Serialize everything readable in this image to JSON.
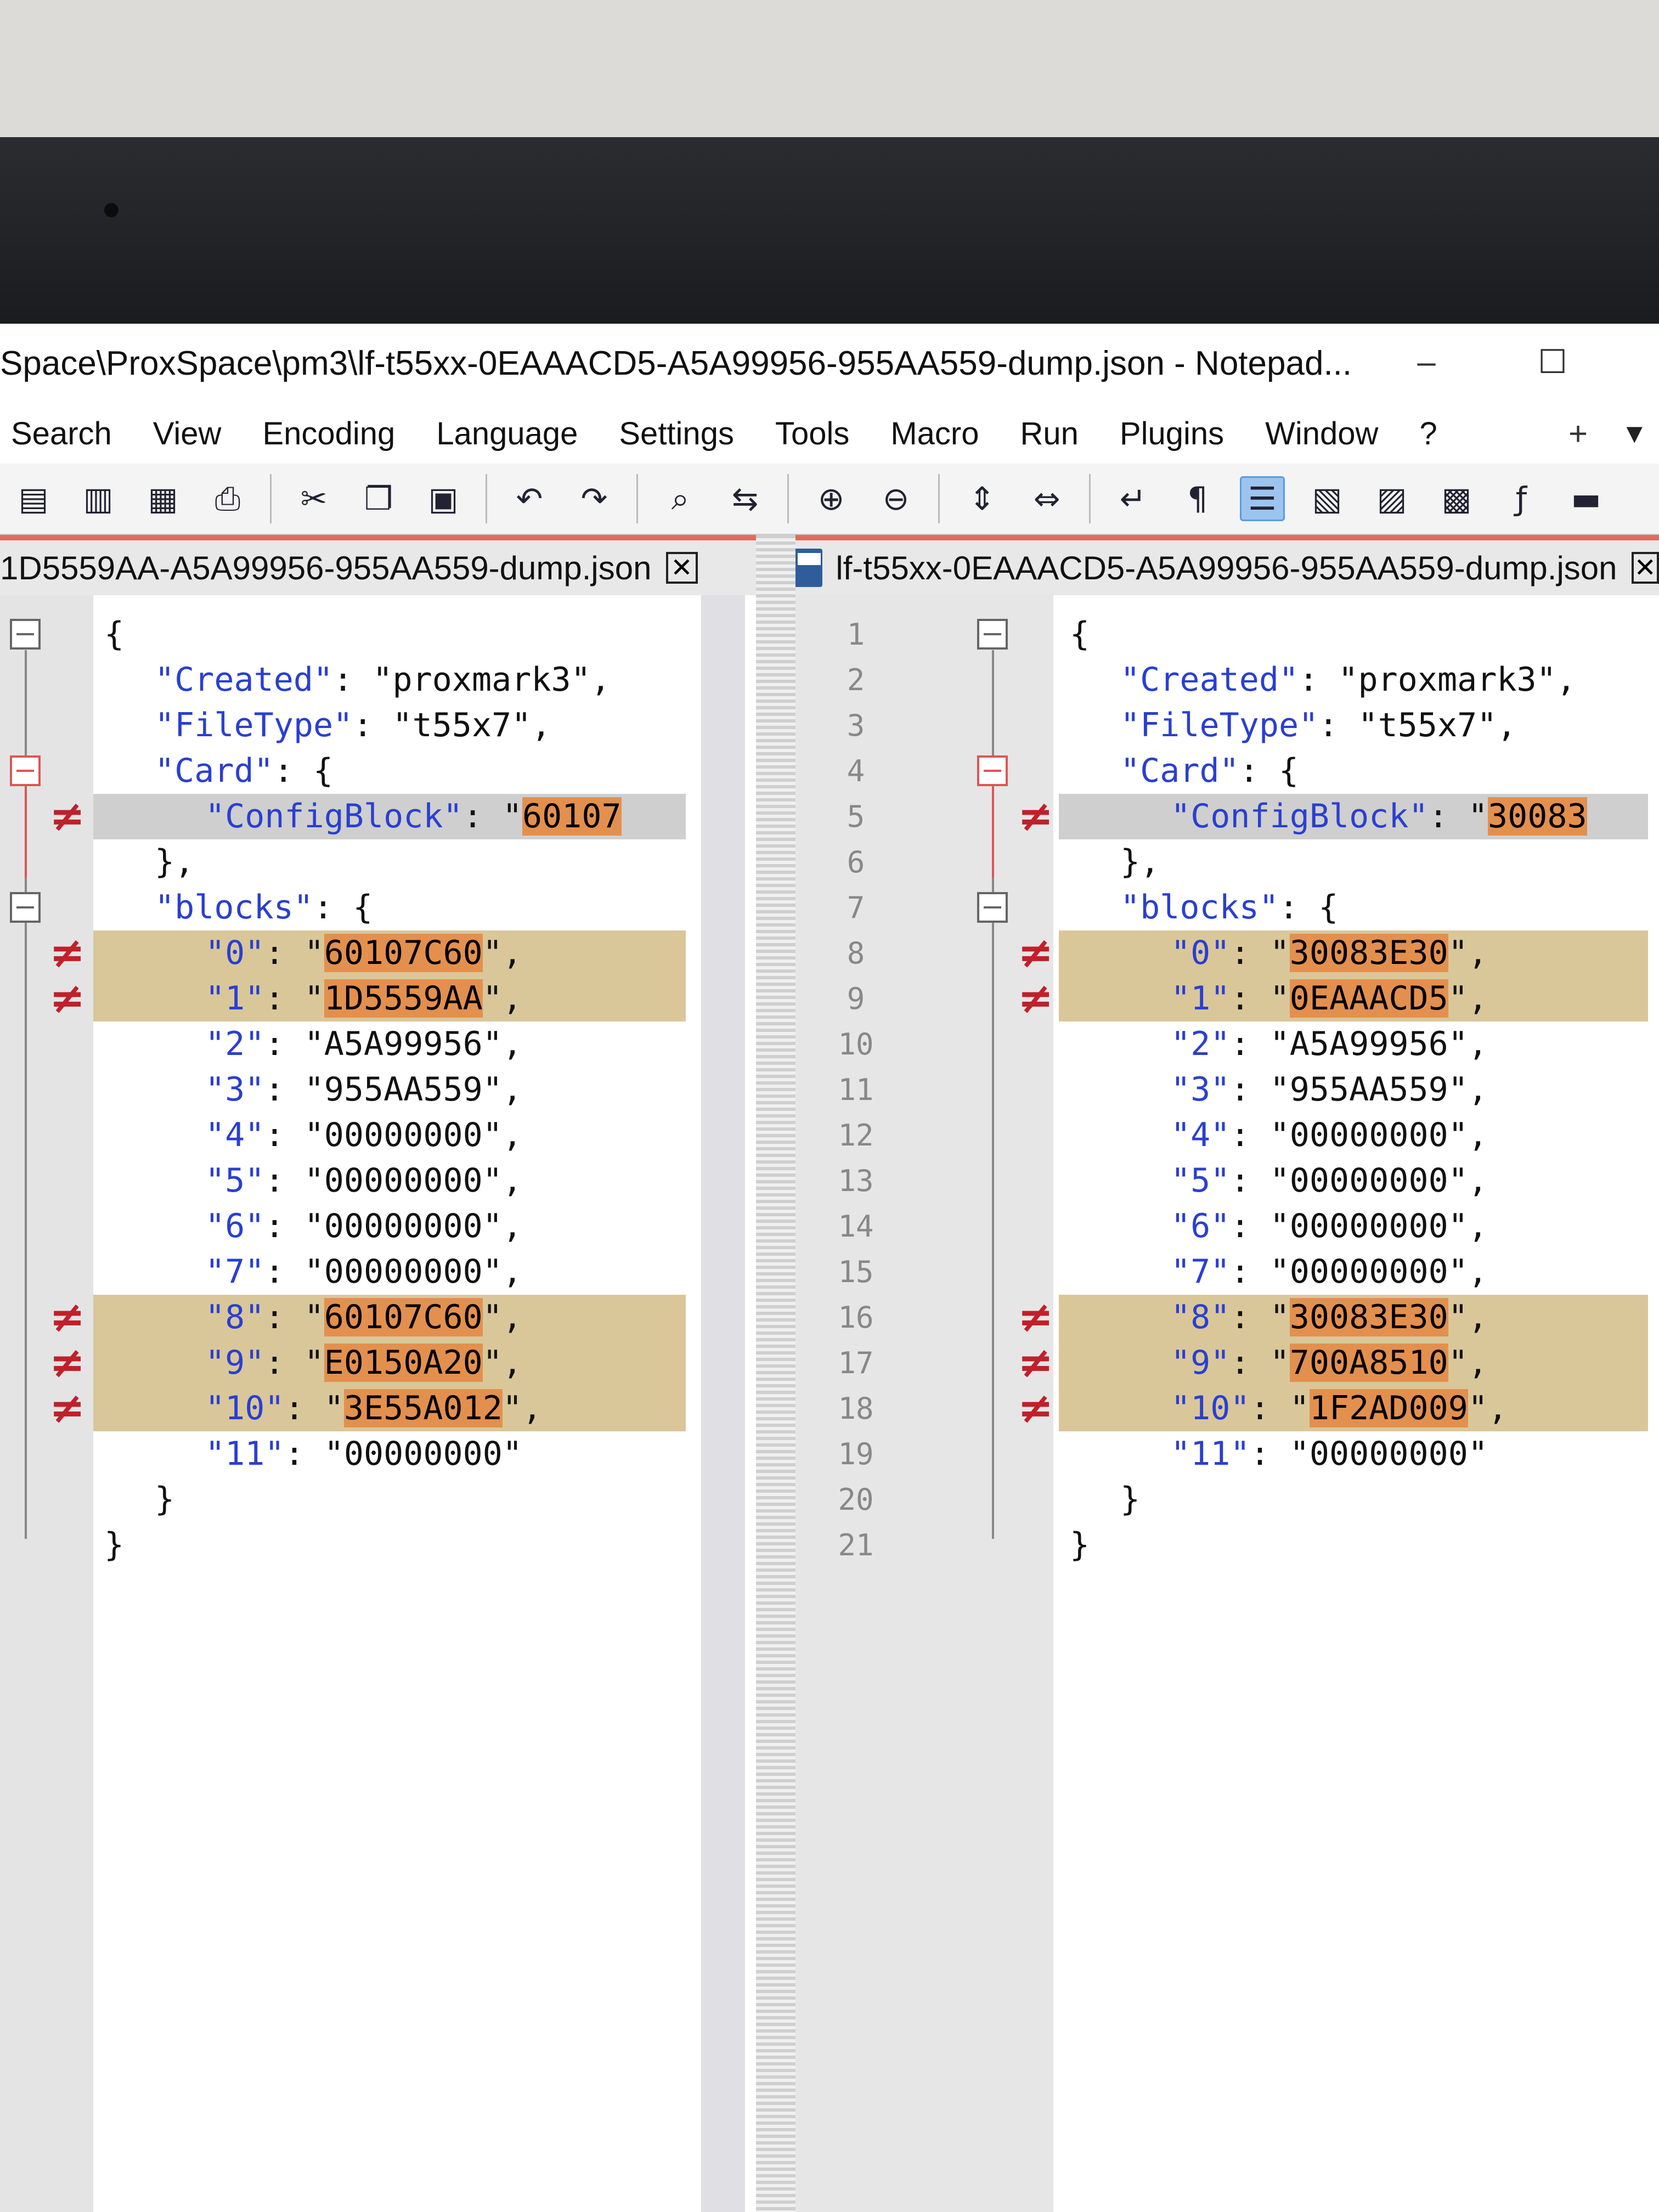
{
  "window": {
    "title": "Space\\ProxSpace\\pm3\\lf-t55xx-0EAAACD5-A5A99956-955AA559-dump.json - Notepad...",
    "minimize_glyph": "–",
    "maximize_glyph": "☐"
  },
  "menu": {
    "items": [
      "Search",
      "View",
      "Encoding",
      "Language",
      "Settings",
      "Tools",
      "Macro",
      "Run",
      "Plugins",
      "Window",
      "?"
    ],
    "plus": "+",
    "dropdown": "▼"
  },
  "toolbar": {
    "icons": [
      "new-file-icon",
      "open-file-icon",
      "save-all-icon",
      "print-icon",
      "cut-icon",
      "copy-icon",
      "paste-icon",
      "undo-icon",
      "redo-icon",
      "find-icon",
      "replace-icon",
      "zoom-in-icon",
      "zoom-out-icon",
      "sync-vertical-icon",
      "sync-horizontal-icon",
      "word-wrap-icon",
      "show-all-chars-icon",
      "indent-guide-icon",
      "doc-map-icon",
      "function-list-icon",
      "folder-workspace-icon",
      "macro-record-icon",
      "macro-stop-icon"
    ],
    "glyphs": {
      "new-file-icon": "▤",
      "open-file-icon": "▥",
      "save-all-icon": "▦",
      "print-icon": "⎙",
      "cut-icon": "✂",
      "copy-icon": "❐",
      "paste-icon": "▣",
      "undo-icon": "↶",
      "redo-icon": "↷",
      "find-icon": "⌕",
      "replace-icon": "⇆",
      "zoom-in-icon": "⊕",
      "zoom-out-icon": "⊖",
      "sync-vertical-icon": "⇕",
      "sync-horizontal-icon": "⇔",
      "word-wrap-icon": "↵",
      "show-all-chars-icon": "¶",
      "indent-guide-icon": "☰",
      "doc-map-icon": "▧",
      "function-list-icon": "▨",
      "folder-workspace-icon": "▩",
      "macro-record-icon": "ƒ",
      "macro-stop-icon": "▬"
    },
    "active": "indent-guide-icon"
  },
  "left": {
    "tab_name": "1D5559AA-A5A99956-955AA559-dump.json",
    "close_glyph": "✕",
    "lines": [
      {
        "text": "{",
        "indent": 0
      },
      {
        "key": "\"Created\"",
        "sep": ": ",
        "value": "\"proxmark3\"",
        "tail": ",",
        "indent": 1
      },
      {
        "key": "\"FileType\"",
        "sep": ": ",
        "value": "\"t55x7\"",
        "tail": ",",
        "indent": 1
      },
      {
        "key": "\"Card\"",
        "sep": ": ",
        "value": "{",
        "tail": "",
        "indent": 1
      },
      {
        "key": "\"ConfigBlock\"",
        "sep": ": ",
        "value": "\"",
        "hl": "60107",
        "tail": "",
        "indent": 2,
        "diff": "gray",
        "marker": true
      },
      {
        "text": "},",
        "indent": 1
      },
      {
        "key": "\"blocks\"",
        "sep": ": ",
        "value": "{",
        "tail": "",
        "indent": 1
      },
      {
        "key": "\"0\"",
        "sep": ": ",
        "value": "\"",
        "hl": "60107C60",
        "tail": "\",",
        "indent": 2,
        "diff": "gold",
        "marker": true
      },
      {
        "key": "\"1\"",
        "sep": ": ",
        "value": "\"",
        "hl": "1D5559AA",
        "tail": "\",",
        "indent": 2,
        "diff": "gold",
        "marker": true
      },
      {
        "key": "\"2\"",
        "sep": ": ",
        "value": "\"A5A99956\"",
        "tail": ",",
        "indent": 2
      },
      {
        "key": "\"3\"",
        "sep": ": ",
        "value": "\"955AA559\"",
        "tail": ",",
        "indent": 2
      },
      {
        "key": "\"4\"",
        "sep": ": ",
        "value": "\"00000000\"",
        "tail": ",",
        "indent": 2
      },
      {
        "key": "\"5\"",
        "sep": ": ",
        "value": "\"00000000\"",
        "tail": ",",
        "indent": 2
      },
      {
        "key": "\"6\"",
        "sep": ": ",
        "value": "\"00000000\"",
        "tail": ",",
        "indent": 2
      },
      {
        "key": "\"7\"",
        "sep": ": ",
        "value": "\"00000000\"",
        "tail": ",",
        "indent": 2
      },
      {
        "key": "\"8\"",
        "sep": ": ",
        "value": "\"",
        "hl": "60107C60",
        "tail": "\",",
        "indent": 2,
        "diff": "gold",
        "marker": true
      },
      {
        "key": "\"9\"",
        "sep": ": ",
        "value": "\"",
        "hl": "E0150A20",
        "tail": "\",",
        "indent": 2,
        "diff": "gold",
        "marker": true
      },
      {
        "key": "\"10\"",
        "sep": ": ",
        "value": "\"",
        "hl": "3E55A012",
        "tail": "\",",
        "indent": 2,
        "diff": "gold",
        "marker": true
      },
      {
        "key": "\"11\"",
        "sep": ": ",
        "value": "\"00000000\"",
        "tail": "",
        "indent": 2
      },
      {
        "text": "}",
        "indent": 1
      },
      {
        "text": "}",
        "indent": 0
      }
    ]
  },
  "right": {
    "tab_name": "lf-t55xx-0EAAACD5-A5A99956-955AA559-dump.json",
    "close_glyph": "✕",
    "line_numbers": [
      "1",
      "2",
      "3",
      "4",
      "5",
      "6",
      "7",
      "8",
      "9",
      "10",
      "11",
      "12",
      "13",
      "14",
      "15",
      "16",
      "17",
      "18",
      "19",
      "20",
      "21"
    ],
    "lines": [
      {
        "text": "{",
        "indent": 0
      },
      {
        "key": "\"Created\"",
        "sep": ": ",
        "value": "\"proxmark3\"",
        "tail": ",",
        "indent": 1
      },
      {
        "key": "\"FileType\"",
        "sep": ": ",
        "value": "\"t55x7\"",
        "tail": ",",
        "indent": 1
      },
      {
        "key": "\"Card\"",
        "sep": ": ",
        "value": "{",
        "tail": "",
        "indent": 1
      },
      {
        "key": "\"ConfigBlock\"",
        "sep": ": ",
        "value": "\"",
        "hl": "30083",
        "tail": "",
        "indent": 2,
        "diff": "gray",
        "marker": true
      },
      {
        "text": "},",
        "indent": 1
      },
      {
        "key": "\"blocks\"",
        "sep": ": ",
        "value": "{",
        "tail": "",
        "indent": 1
      },
      {
        "key": "\"0\"",
        "sep": ": ",
        "value": "\"",
        "hl": "30083E30",
        "tail": "\",",
        "indent": 2,
        "diff": "gold",
        "marker": true
      },
      {
        "key": "\"1\"",
        "sep": ": ",
        "value": "\"",
        "hl": "0EAAACD5",
        "tail": "\",",
        "indent": 2,
        "diff": "gold",
        "marker": true
      },
      {
        "key": "\"2\"",
        "sep": ": ",
        "value": "\"A5A99956\"",
        "tail": ",",
        "indent": 2
      },
      {
        "key": "\"3\"",
        "sep": ": ",
        "value": "\"955AA559\"",
        "tail": ",",
        "indent": 2
      },
      {
        "key": "\"4\"",
        "sep": ": ",
        "value": "\"00000000\"",
        "tail": ",",
        "indent": 2
      },
      {
        "key": "\"5\"",
        "sep": ": ",
        "value": "\"00000000\"",
        "tail": ",",
        "indent": 2
      },
      {
        "key": "\"6\"",
        "sep": ": ",
        "value": "\"00000000\"",
        "tail": ",",
        "indent": 2
      },
      {
        "key": "\"7\"",
        "sep": ": ",
        "value": "\"00000000\"",
        "tail": ",",
        "indent": 2
      },
      {
        "key": "\"8\"",
        "sep": ": ",
        "value": "\"",
        "hl": "30083E30",
        "tail": "\",",
        "indent": 2,
        "diff": "gold",
        "marker": true
      },
      {
        "key": "\"9\"",
        "sep": ": ",
        "value": "\"",
        "hl": "700A8510",
        "tail": "\",",
        "indent": 2,
        "diff": "gold",
        "marker": true
      },
      {
        "key": "\"10\"",
        "sep": ": ",
        "value": "\"",
        "hl": "1F2AD009",
        "tail": "\",",
        "indent": 2,
        "diff": "gold",
        "marker": true
      },
      {
        "key": "\"11\"",
        "sep": ": ",
        "value": "\"00000000\"",
        "tail": "",
        "indent": 2
      },
      {
        "text": "}",
        "indent": 1
      },
      {
        "text": "}",
        "indent": 0
      }
    ]
  },
  "diff_marker_glyph": "≠",
  "colors": {
    "key": "#2a3fd1",
    "diff_line": "#d9c79a",
    "diff_highlight": "#e3904e",
    "diff_marker": "#c0202a",
    "tab_accent": "#e06c5c"
  }
}
